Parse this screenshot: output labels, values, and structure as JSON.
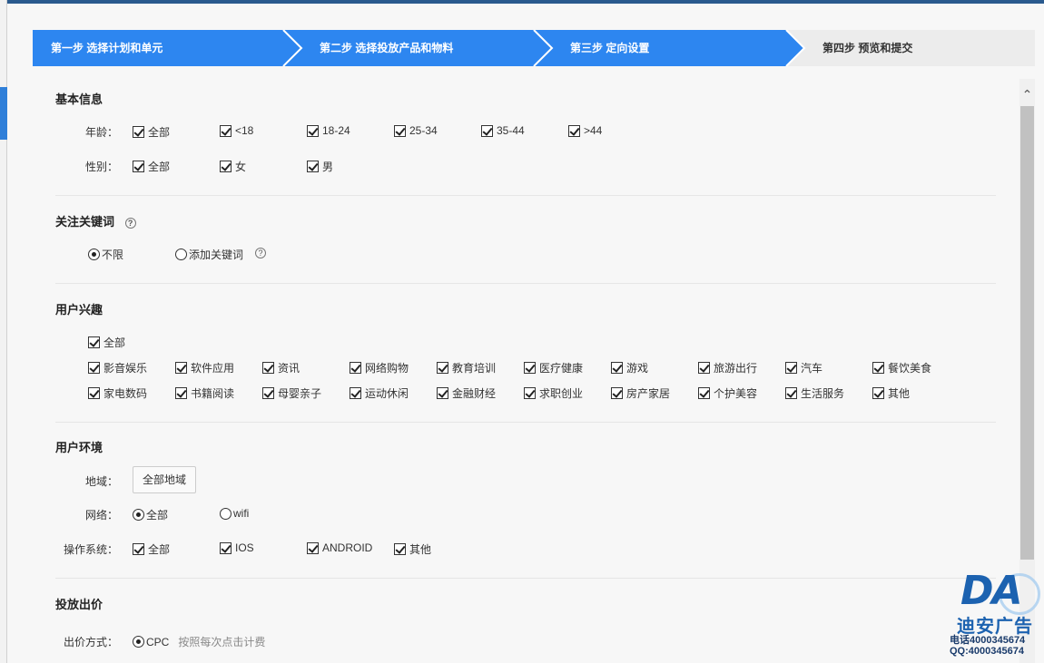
{
  "steps": [
    {
      "label": "第一步 选择计划和单元",
      "state": "active"
    },
    {
      "label": "第二步 选择投放产品和物料",
      "state": "active"
    },
    {
      "label": "第三步 定向设置",
      "state": "active"
    },
    {
      "label": "第四步 预览和提交",
      "state": "inactive"
    }
  ],
  "colors": {
    "accent": "#2d86f0",
    "step_inactive": "#ececec"
  },
  "basic": {
    "title": "基本信息",
    "age_label": "年龄：",
    "ages": [
      "全部",
      "<18",
      "18-24",
      "25-34",
      "35-44",
      ">44"
    ],
    "gender_label": "性别：",
    "genders": [
      "全部",
      "女",
      "男"
    ]
  },
  "keywords": {
    "title": "关注关键词",
    "help_icon": "question-circle-icon",
    "help_glyph": "?",
    "options": [
      "不限",
      "添加关键词"
    ],
    "selected": "不限"
  },
  "interests": {
    "title": "用户兴趣",
    "all_label": "全部",
    "row1": [
      "影音娱乐",
      "软件应用",
      "资讯",
      "网络购物",
      "教育培训",
      "医疗健康",
      "游戏",
      "旅游出行",
      "汽车",
      "餐饮美食"
    ],
    "row2": [
      "家电数码",
      "书籍阅读",
      "母婴亲子",
      "运动休闲",
      "金融财经",
      "求职创业",
      "房产家居",
      "个护美容",
      "生活服务",
      "其他"
    ]
  },
  "environment": {
    "title": "用户环境",
    "region_label": "地域：",
    "region_button": "全部地域",
    "network_label": "网络：",
    "network_options": [
      "全部",
      "wifi"
    ],
    "network_selected": "全部",
    "os_label": "操作系统：",
    "os_options": [
      "全部",
      "IOS",
      "ANDROID",
      "其他"
    ]
  },
  "bid": {
    "title": "投放出价",
    "method_label": "出价方式：",
    "method_option": "CPC",
    "method_hint": "按照每次点击计费"
  },
  "watermark": {
    "logo_text": "DA",
    "name": "迪安广告",
    "phone": "电话4000345674",
    "qq": "QQ:4000345674"
  }
}
